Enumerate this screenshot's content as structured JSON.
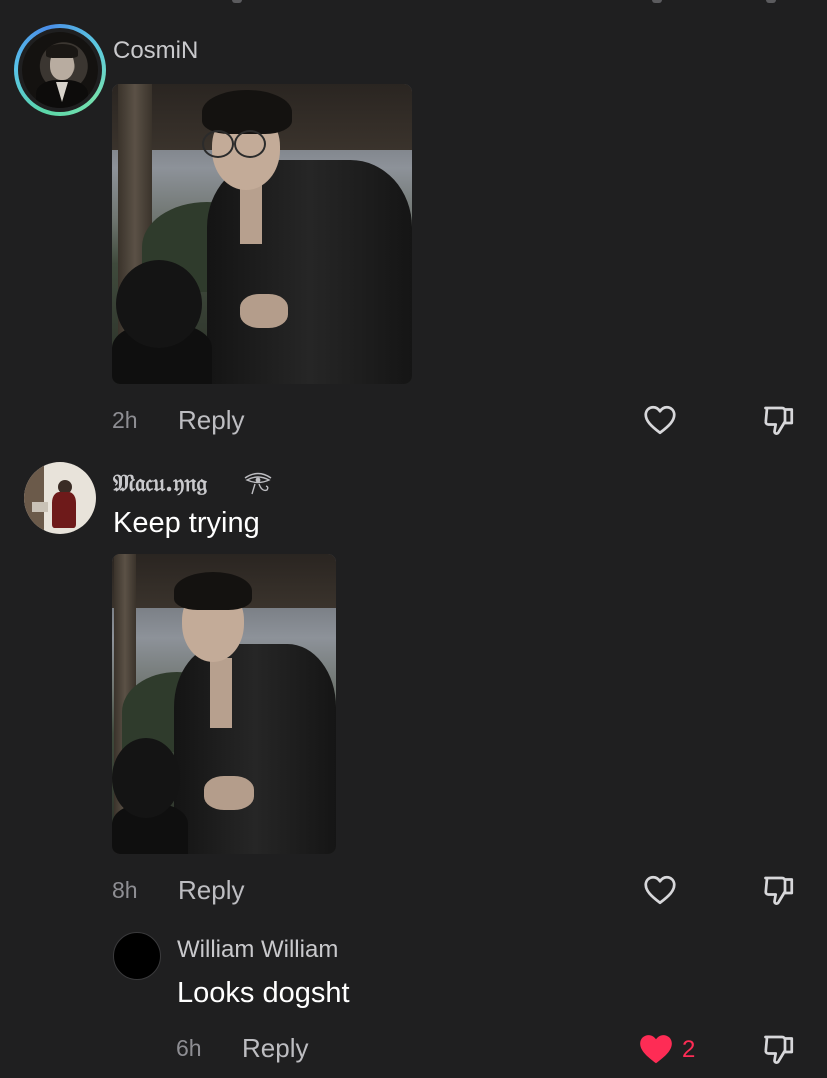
{
  "comments": [
    {
      "username": "CosmiN",
      "time": "2h",
      "reply_label": "Reply",
      "has_story_ring": true,
      "liked": false,
      "attachment": "photo"
    },
    {
      "username": "𝔐𝔞𝔠𝔲.𝔶𝔫𝔤",
      "text": "Keep trying",
      "time": "8h",
      "reply_label": "Reply",
      "liked": false,
      "attachment": "photo"
    }
  ],
  "reply": {
    "username": "William William",
    "text": "Looks dogsht",
    "time": "6h",
    "reply_label": "Reply",
    "liked": true,
    "like_count": "2"
  },
  "icons": {
    "like": "heart-outline-icon",
    "liked": "heart-filled-icon",
    "dislike": "thumbs-down-icon",
    "badge": "eye-of-horus-icon"
  },
  "colors": {
    "background": "#1f1f20",
    "text_primary": "#ffffff",
    "text_secondary": "#8e8e93",
    "like_active": "#fe2c55",
    "story_ring": "#59c3e9"
  }
}
